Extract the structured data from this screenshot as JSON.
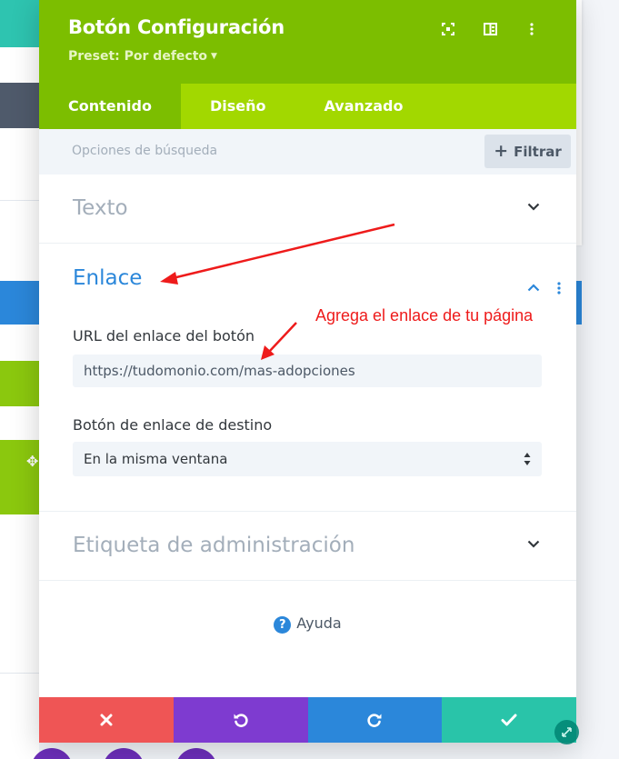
{
  "window": {
    "title": "Botón Configuración",
    "preset": "Preset: Por defecto"
  },
  "header_icons": [
    "focus-icon",
    "split-view-icon",
    "more-vertical-icon"
  ],
  "tabs": [
    {
      "label": "Contenido",
      "active": true
    },
    {
      "label": "Diseño",
      "active": false
    },
    {
      "label": "Avanzado",
      "active": false
    }
  ],
  "search": {
    "placeholder": "Opciones de búsqueda",
    "filter_label": "Filtrar"
  },
  "sections": {
    "texto": {
      "title": "Texto",
      "expanded": false
    },
    "enlace": {
      "title": "Enlace",
      "expanded": true,
      "url_label": "URL del enlace del botón",
      "url_value": "https://tudomonio.com/mas-adopciones",
      "target_label": "Botón de enlace de destino",
      "target_value": "En la misma ventana"
    },
    "admin": {
      "title": "Etiqueta de administración",
      "expanded": false
    }
  },
  "help": {
    "label": "Ayuda"
  },
  "annotation": {
    "text": "Agrega el enlace de tu página"
  },
  "colors": {
    "header": "#7cbe00",
    "tabs": "#a2d800",
    "link_blue": "#2b87da",
    "cancel": "#ef5555",
    "undo": "#7e3bd0",
    "redo": "#2b87da",
    "save": "#29c4a9",
    "annotation": "#ee1b1b"
  }
}
